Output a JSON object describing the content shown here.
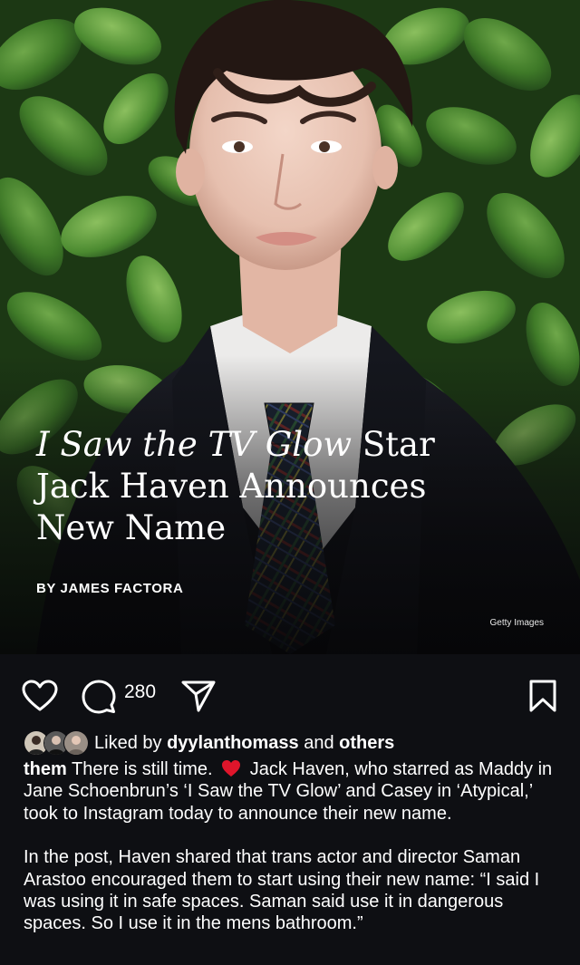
{
  "post": {
    "headline_line1_italic": "I Saw the TV Glow",
    "headline_line1_rest": " Star",
    "headline_line2": "Jack Haven Announces",
    "headline_line3": "New Name",
    "byline": "BY JAMES FACTORA",
    "image_credit": "Getty Images"
  },
  "actions": {
    "comment_count": "280",
    "icons": [
      "heart-icon",
      "comment-icon",
      "share-icon",
      "bookmark-icon"
    ]
  },
  "likes": {
    "prefix": "Liked by ",
    "user": "dyylanthomass",
    "middle": " and ",
    "others": "others"
  },
  "caption": {
    "username": "them",
    "text_before_emoji": " There is still time. ",
    "emoji": "red-heart",
    "text_after_emoji": " Jack Haven, who starred as Maddy in Jane Schoenbrun’s ‘I Saw the TV Glow’ and Casey in ‘Atypical,’ took to Instagram today to announce their new name.",
    "paragraph2": "In the post, Haven shared that trans actor and director Saman Arastoo encouraged them to start using their new name: “I said I was using it in safe spaces. Saman said use it in dangerous spaces. So I use it in the mens bathroom.”"
  },
  "colors": {
    "background": "#0e0f13",
    "text": "#ffffff",
    "heart_emoji": "#e0152b"
  }
}
